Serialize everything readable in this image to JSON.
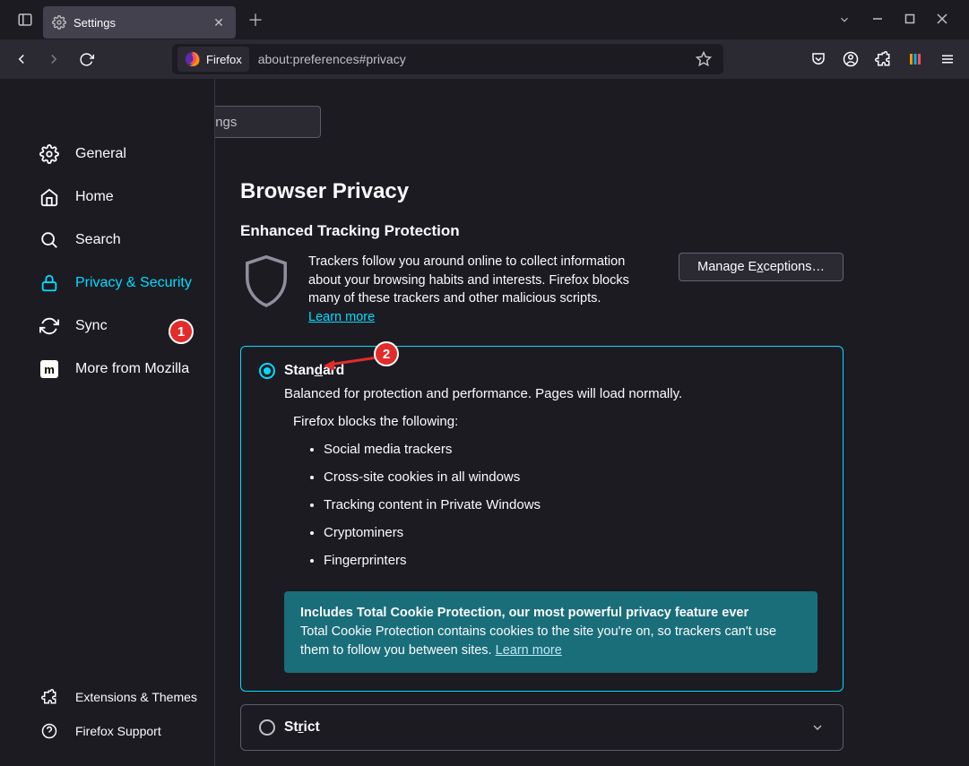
{
  "window": {
    "tab_title": "Settings"
  },
  "toolbar": {
    "firefox_label": "Firefox",
    "url": "about:preferences#privacy"
  },
  "sidebar": {
    "items": [
      {
        "label": "General"
      },
      {
        "label": "Home"
      },
      {
        "label": "Search"
      },
      {
        "label": "Privacy & Security"
      },
      {
        "label": "Sync"
      },
      {
        "label": "More from Mozilla"
      }
    ],
    "footer": [
      {
        "label": "Extensions & Themes"
      },
      {
        "label": "Firefox Support"
      }
    ]
  },
  "content": {
    "search_placeholder": "Find in Settings",
    "page_title": "Browser Privacy",
    "etp_heading": "Enhanced Tracking Protection",
    "etp_intro": "Trackers follow you around online to collect information about your browsing habits and interests. Firefox blocks many of these trackers and other malicious scripts.",
    "learn_more": "Learn more",
    "manage_exceptions": "Manage Exceptions…",
    "standard": {
      "title_pre": "Stan",
      "title_u": "d",
      "title_post": "ard",
      "subtitle": "Balanced for protection and performance. Pages will load normally.",
      "blocks_label": "Firefox blocks the following:",
      "blocks": [
        "Social media trackers",
        "Cross-site cookies in all windows",
        "Tracking content in Private Windows",
        "Cryptominers",
        "Fingerprinters"
      ],
      "tcp_title": "Includes Total Cookie Protection, our most powerful privacy feature ever",
      "tcp_body": "Total Cookie Protection contains cookies to the site you're on, so trackers can't use them to follow you between sites.",
      "tcp_link": "Learn more"
    },
    "strict": {
      "title_pre": "St",
      "title_u": "r",
      "title_post": "ict"
    }
  },
  "annotations": {
    "marker1": "1",
    "marker2": "2"
  }
}
